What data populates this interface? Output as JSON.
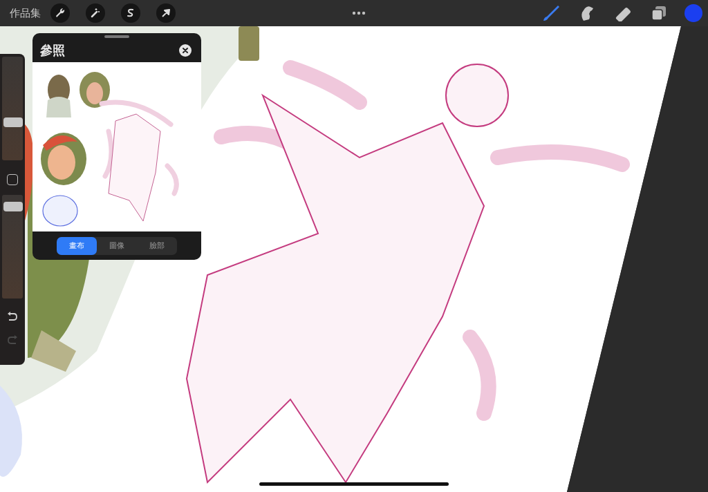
{
  "top_bar": {
    "gallery_label": "作品集",
    "tools": [
      {
        "kind": "brush",
        "selected": true
      },
      {
        "kind": "smudge",
        "selected": false
      },
      {
        "kind": "eraser",
        "selected": false
      }
    ],
    "color_swatch": {
      "color": "#1b3ff0"
    }
  },
  "sidebar": {
    "sliders": [
      {
        "level": 0.35
      },
      {
        "level": 0.93
      }
    ],
    "undo": {
      "disabled": false
    },
    "redo": {
      "disabled": true
    }
  },
  "reference_panel": {
    "title": "參照",
    "tabs": [
      {
        "label": "畫布",
        "selected": true
      },
      {
        "label": "圖像",
        "selected": false
      },
      {
        "label": "臉部",
        "selected": false
      }
    ]
  }
}
